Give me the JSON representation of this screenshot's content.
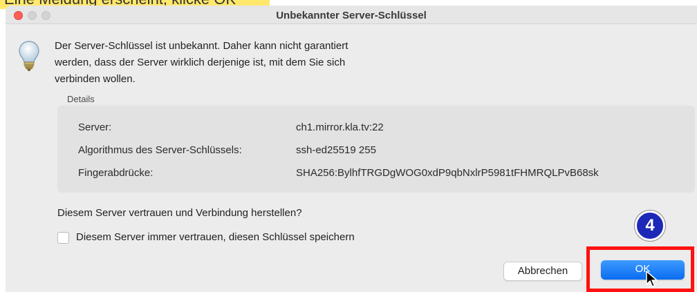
{
  "caption": {
    "text": "Eine Meldung erscheint, klicke OK"
  },
  "window": {
    "title": "Unbekannter Server-Schlüssel",
    "icon": "lightbulb-icon"
  },
  "message": "Der Server-Schlüssel ist unbekannt. Daher kann nicht garantiert\nwerden, dass der Server wirklich derjenige ist, mit dem Sie sich\nverbinden wollen.",
  "details": {
    "label": "Details",
    "rows": [
      {
        "key": "Server:",
        "value": "ch1.mirror.kla.tv:22"
      },
      {
        "key": "Algorithmus des Server-Schlüssels:",
        "value": "ssh-ed25519 255"
      },
      {
        "key": "Fingerabdrücke:",
        "value": "SHA256:BylhfTRGDgWOG0xdP9qbNxlrP5981tFHMRQLPvB68sk"
      }
    ]
  },
  "question": "Diesem Server vertrauen und Verbindung herstellen?",
  "checkbox": {
    "label": "Diesem Server immer vertrauen, diesen Schlüssel speichern",
    "checked": false
  },
  "buttons": {
    "cancel": "Abbrechen",
    "ok": "OK"
  },
  "annotation": {
    "step": "4",
    "highlight_color": "#ff1111",
    "badge_color": "#1d28b8"
  },
  "colors": {
    "close_light": "#ff5f57",
    "ok_button": "#1a7cf5"
  }
}
